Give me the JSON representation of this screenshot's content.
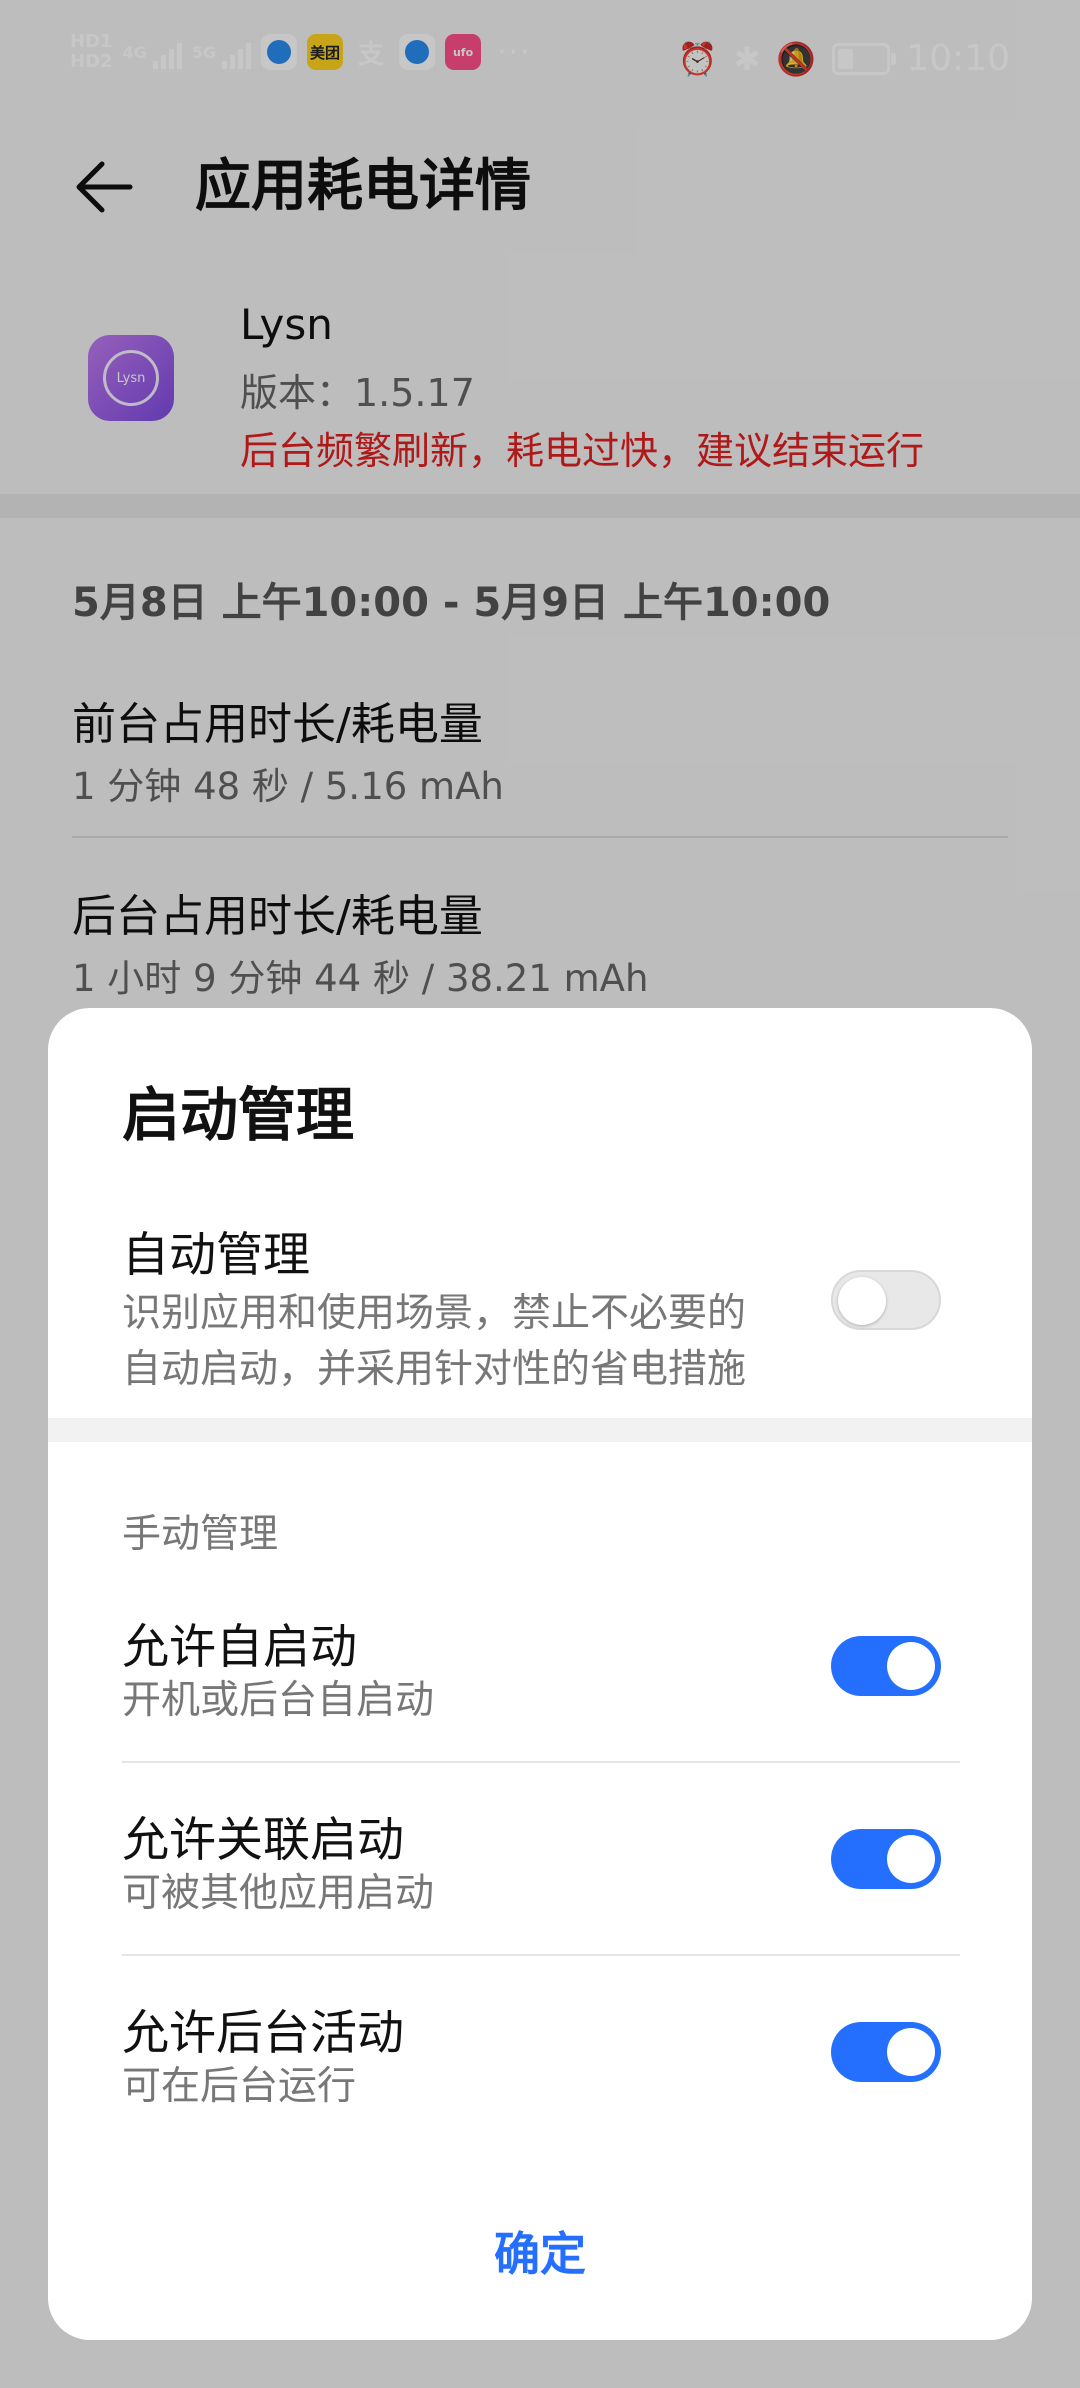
{
  "status_bar": {
    "hd1": "HD1",
    "hd2": "HD2",
    "net1": "4G",
    "net2": "5G",
    "meituan_label": "美团",
    "alipay_label": "支",
    "more": "···",
    "time": "10:10"
  },
  "header": {
    "title": "应用耗电详情"
  },
  "app": {
    "icon_text": "Lysn",
    "name": "Lysn",
    "version": "版本：1.5.17",
    "warning": "后台频繁刷新，耗电过快，建议结束运行",
    "warning_color": "#e02020"
  },
  "usage": {
    "date_range": "5月8日 上午10:00 - 5月9日 上午10:00",
    "foreground_title": "前台占用时长/耗电量",
    "foreground_value": "1 分钟 48 秒 / 5.16 mAh",
    "background_title": "后台占用时长/耗电量",
    "background_value": "1 小时 9 分钟 44 秒 / 38.21 mAh"
  },
  "dialog": {
    "title": "启动管理",
    "auto": {
      "title": "自动管理",
      "desc_line1": "识别应用和使用场景，禁止不必要的",
      "desc_line2": "自动启动，并采用针对性的省电措施",
      "enabled": false
    },
    "manual_label": "手动管理",
    "items": [
      {
        "title": "允许自启动",
        "desc": "开机或后台自启动",
        "enabled": true
      },
      {
        "title": "允许关联启动",
        "desc": "可被其他应用启动",
        "enabled": true
      },
      {
        "title": "允许后台活动",
        "desc": "可在后台运行",
        "enabled": true
      }
    ],
    "confirm_label": "确定",
    "accent_color": "#256fff"
  }
}
